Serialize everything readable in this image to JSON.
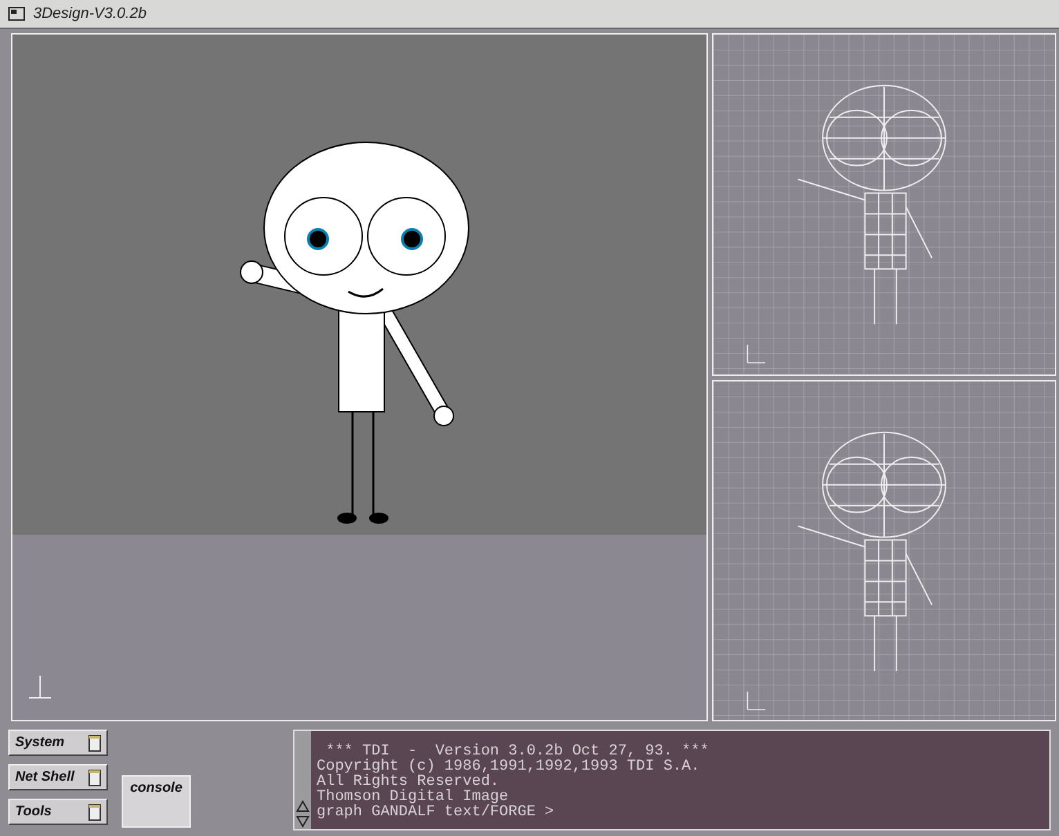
{
  "window": {
    "title": "3Design-V3.0.2b"
  },
  "shelf_buttons": [
    {
      "label": "System"
    },
    {
      "label": "Net Shell"
    },
    {
      "label": "Tools"
    }
  ],
  "console_button": {
    "label": "console"
  },
  "console": {
    "lines": [
      " *** TDI  -  Version 3.0.2b Oct 27, 93. ***",
      "Copyright (c) 1986,1991,1992,1993 TDI S.A.",
      "All Rights Reserved.",
      "Thomson Digital Image",
      "graph GANDALF text/FORGE >"
    ]
  }
}
